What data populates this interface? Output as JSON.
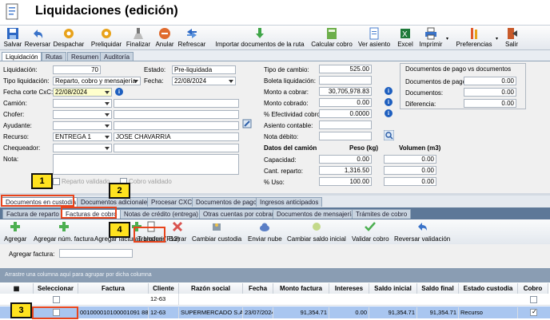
{
  "window": {
    "title": "Liquidaciones (edición)"
  },
  "toolbar": {
    "buttons": [
      {
        "id": "save",
        "label": "Salvar",
        "icon": "save-icon"
      },
      {
        "id": "reverse",
        "label": "Reversar",
        "icon": "undo-icon"
      },
      {
        "id": "dispatch",
        "label": "Despachar",
        "icon": "gear-icon"
      },
      {
        "id": "preliquidate",
        "label": "Preliquidar",
        "icon": "gear-icon"
      },
      {
        "id": "finalize",
        "label": "Finalizar",
        "icon": "broom-icon"
      },
      {
        "id": "cancel",
        "label": "Anular",
        "icon": "cancel-icon"
      },
      {
        "id": "refresh",
        "label": "Refrescar",
        "icon": "refresh-icon"
      },
      {
        "id": "import",
        "label": "Importar documentos de la ruta",
        "icon": "import-icon"
      },
      {
        "id": "calc",
        "label": "Calcular cobro",
        "icon": "calculator-icon"
      },
      {
        "id": "entry",
        "label": "Ver asiento",
        "icon": "document-icon"
      },
      {
        "id": "excel",
        "label": "Excel",
        "icon": "excel-icon"
      },
      {
        "id": "print",
        "label": "Imprimir",
        "icon": "printer-icon"
      },
      {
        "id": "prefs",
        "label": "Preferencias",
        "icon": "settings-icon"
      },
      {
        "id": "exit",
        "label": "Salir",
        "icon": "exit-icon"
      }
    ]
  },
  "main_tabs": [
    "Liquidación",
    "Rutas",
    "Resumen",
    "Auditoría"
  ],
  "form": {
    "liquidacion_label": "Liquidación:",
    "liquidacion_value": "70",
    "estado_label": "Estado:",
    "estado_value": "Pre-liquidada",
    "tipo_label": "Tipo liquidación:",
    "tipo_value": "Reparto, cobro y mensajería",
    "fecha_label": "Fecha:",
    "fecha_value": "22/08/2024",
    "corte_label": "Fecha corte CxC:",
    "corte_value": "22/08/2024",
    "camion_label": "Camión:",
    "chofer_label": "Chofer:",
    "ayudante_label": "Ayudante:",
    "recurso_label": "Recurso:",
    "recurso_value": "ENTREGA 1",
    "recurso_name": "JOSE CHAVARRIA",
    "chequeador_label": "Chequeador:",
    "nota_label": "Nota:",
    "reparto_validado": "Reparto validado",
    "cobro_validado": "Cobro validado",
    "tipo_cambio_label": "Tipo de cambio:",
    "tipo_cambio_value": "525.00",
    "boleta_label": "Boleta liquidación:",
    "monto_cobrar_label": "Monto a cobrar:",
    "monto_cobrar_value": "30,705,978.83",
    "monto_cobrado_label": "Monto cobrado:",
    "monto_cobrado_value": "0.00",
    "efectividad_label": "% Efectividad cobro:",
    "efectividad_value": "0.0000",
    "asiento_label": "Asiento contable:",
    "nota_debito_label": "Nota débito:",
    "camion_data_title": "Datos del camión",
    "peso_label": "Peso (kg)",
    "volumen_label": "Volumen (m3)",
    "capacidad_label": "Capacidad:",
    "capacidad_peso": "0.00",
    "capacidad_vol": "0.00",
    "cant_reparto_label": "Cant. reparto:",
    "cant_reparto_peso": "1,316.50",
    "cant_reparto_vol": "0.00",
    "uso_label": "% Uso:",
    "uso_peso": "100.00",
    "uso_vol": "0.00",
    "docs_group_title": "Documentos de pago vs documentos",
    "docs_pago_label": "Documentos de pago:",
    "docs_pago_value": "0.00",
    "docs_label": "Documentos:",
    "docs_value": "0.00",
    "diferencia_label": "Diferencia:",
    "diferencia_value": "0.00"
  },
  "doc_tabs": [
    "Documentos en custodia",
    "Documentos adicionales",
    "Procesar CXC",
    "Documentos de pago",
    "Ingresos anticipados"
  ],
  "sub_tabs": [
    "Factura de reparto",
    "Facturas de cobro",
    "Notas de crédito (entrega)",
    "Otras cuentas por cobrar",
    "Documentos de mensajería",
    "Trámites de cobro"
  ],
  "actions": [
    "Agregar",
    "Agregar núm. factura",
    "Agregar facturas bloque (F12)",
    "Transferir",
    "Borrar",
    "Cambiar custodia",
    "Enviar nube",
    "Cambiar saldo inicial",
    "Validar cobro",
    "Reversar validación"
  ],
  "add_invoice_label": "Agregar factura:",
  "group_hint": "Arrastre una columna aquí para agrupar por dicha columna",
  "grid": {
    "columns": [
      "Seleccionar",
      "Factura",
      "Cliente",
      "Razón social",
      "Fecha",
      "Monto factura",
      "Intereses",
      "Saldo inicial",
      "Saldo final",
      "Estado custodia",
      "Cobro"
    ],
    "filter_cliente": "12-63",
    "row": {
      "factura": "001000010100001091 88",
      "cliente": "12-63",
      "razon": "SUPERMERCADO S.A.",
      "fecha": "23/07/2024",
      "monto": "91,354.71",
      "intereses": "0.00",
      "saldo_inicial": "91,354.71",
      "saldo_final": "91,354.71",
      "estado": "Recurso"
    }
  },
  "callouts": [
    "1",
    "2",
    "3",
    "4"
  ],
  "colors": {
    "accent": "#1e5fbf",
    "highlight_row": "#a9c6f0",
    "callout": "#ffe21f",
    "redbox": "#e8441c"
  }
}
